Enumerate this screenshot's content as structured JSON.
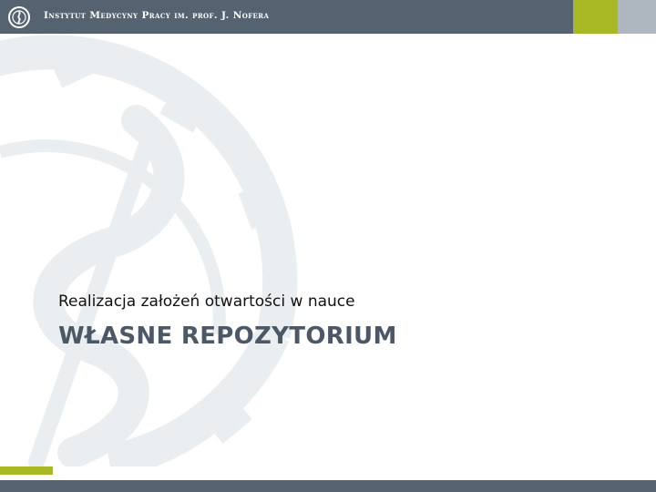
{
  "header": {
    "institution_name": "Instytut Medycyny Pracy im. prof. J. Nofera",
    "logo_icon": "caduceus-gear-logo-icon"
  },
  "slide": {
    "subtitle": "Realizacja założeń otwartości w nauce",
    "title": "WŁASNE REPOZYTORIUM"
  },
  "colors": {
    "header_bar": "#556270",
    "accent_green": "#a9b926",
    "accent_grey": "#aeb6bf",
    "title_text": "#4c5866",
    "watermark": "#ebeef0"
  }
}
